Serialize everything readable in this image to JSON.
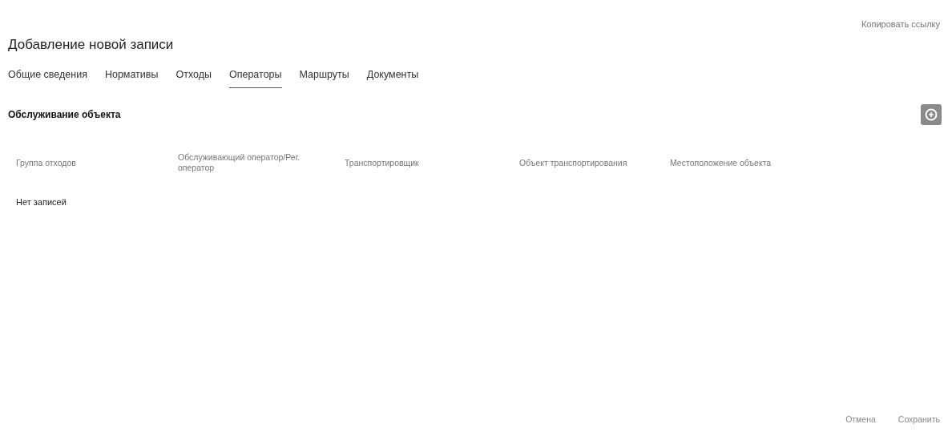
{
  "header": {
    "link": "Копировать ссылку",
    "title": "Добавление новой записи"
  },
  "tabs": [
    {
      "label": "Общие сведения",
      "selected": false
    },
    {
      "label": "Нормативы",
      "selected": false
    },
    {
      "label": "Отходы",
      "selected": false
    },
    {
      "label": "Операторы",
      "selected": true
    },
    {
      "label": "Маршруты",
      "selected": false
    },
    {
      "label": "Документы",
      "selected": false
    }
  ],
  "section": {
    "title": "Обслуживание объекта"
  },
  "table": {
    "columns": [
      "Группа отходов",
      "Обслуживающий оператор/Рег. оператор",
      "Транспортировщик",
      "Объект транспортирования",
      "Местоположение объекта"
    ],
    "empty": "Нет записей"
  },
  "footer": {
    "buttons": [
      "Отмена",
      "Сохранить"
    ]
  }
}
